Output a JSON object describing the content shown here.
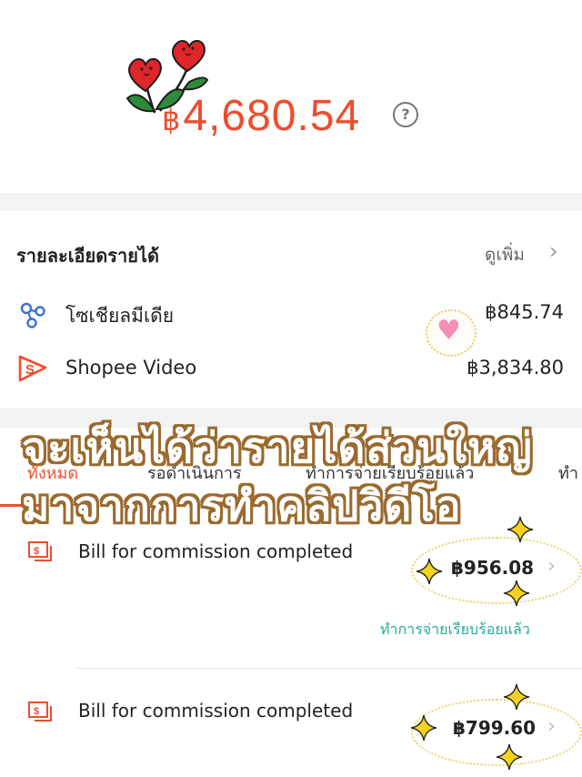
{
  "balance": {
    "currency": "฿",
    "amount": "4,680.54",
    "help_icon": "?"
  },
  "income_details": {
    "title": "รายละเอียดรายได้",
    "see_more": "ดูเพิ่ม",
    "rows": [
      {
        "icon": "social-share-icon",
        "label": "โซเชียลมีเดีย",
        "value": "฿845.74"
      },
      {
        "icon": "shopee-video-icon",
        "label": "Shopee Video",
        "value": "฿3,834.80"
      }
    ]
  },
  "tabs": [
    "ทั้งหมด",
    "รอดำเนินการ",
    "ทำการจ่ายเรียบร้อยแล้ว",
    "ทำ"
  ],
  "overlay": {
    "line1": "จะเห็นได้ว่ารายได้ส่วนใหญ่",
    "line2": "มาจากการทำคลิปวิดีโอ"
  },
  "bills": [
    {
      "title": "Bill for commission completed",
      "amount": "฿956.08",
      "status": "ทำการจ่ายเรียบร้อยแล้ว"
    },
    {
      "title": "Bill for commission completed",
      "amount": "฿799.60"
    }
  ],
  "colors": {
    "accent": "#ee4d2d",
    "paid_green": "#26aa99",
    "sticker_brown": "#9a6a2e",
    "star_yellow": "#f5d21f"
  }
}
